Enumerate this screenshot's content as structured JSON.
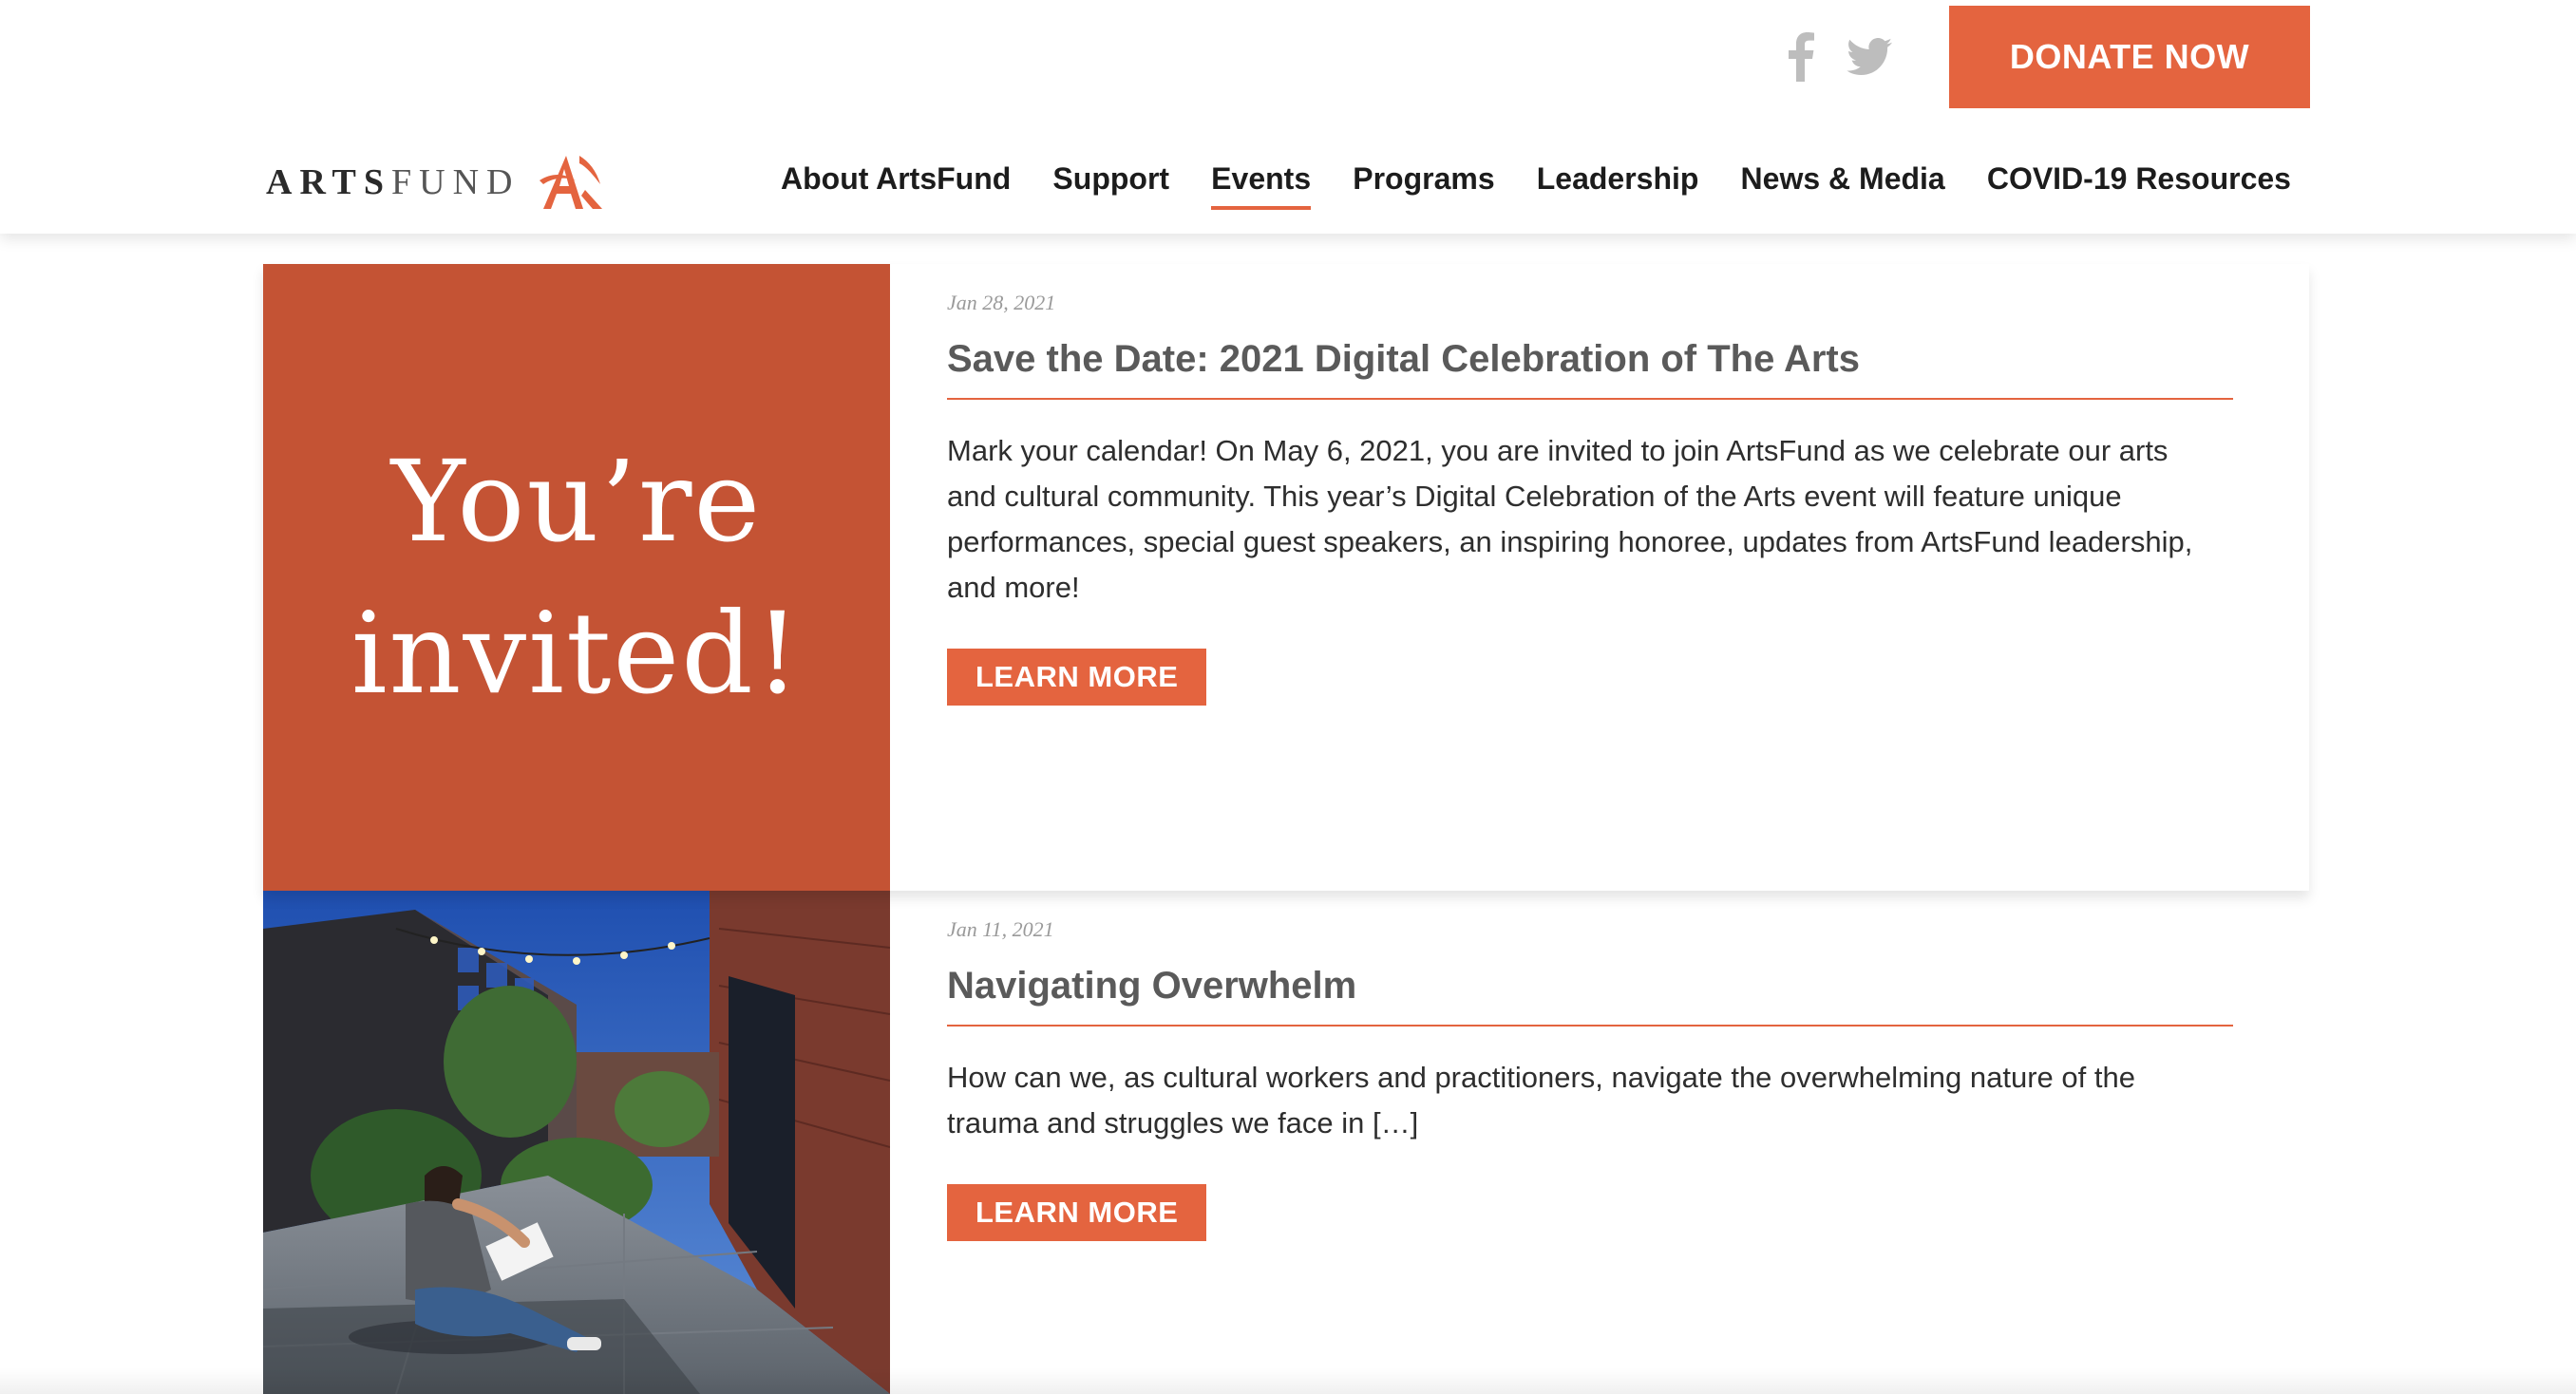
{
  "header": {
    "logo_text_bold": "ARTS",
    "logo_text_light": "FUND",
    "donate_label": "DONATE NOW",
    "social": [
      {
        "icon": "facebook-icon"
      },
      {
        "icon": "twitter-icon"
      }
    ],
    "nav": [
      {
        "label": "About ArtsFund"
      },
      {
        "label": "Support"
      },
      {
        "label": "Events",
        "active": true
      },
      {
        "label": "Programs"
      },
      {
        "label": "Leadership"
      },
      {
        "label": "News & Media"
      },
      {
        "label": "COVID-19 Resources"
      }
    ]
  },
  "posts": [
    {
      "date": "Jan 28, 2021",
      "title": "Save the Date: 2021 Digital Celebration of The Arts",
      "excerpt": "Mark your calendar! On May 6, 2021, you are invited to join ArtsFund as we celebrate our arts and cultural community. This year’s Digital Celebration of the Arts event will feature unique performances, special guest speakers, an inspiring honoree, updates from ArtsFund leadership, and more!",
      "image_text_line1": "You’re",
      "image_text_line2": "invited!",
      "button": "LEARN MORE"
    },
    {
      "date": "Jan 11, 2021",
      "title": "Navigating Overwhelm",
      "excerpt": "How can we, as cultural workers and practitioners, navigate the overwhelming nature of the trauma and struggles we face in […]",
      "button": "LEARN MORE"
    }
  ],
  "colors": {
    "accent": "#e4643f",
    "invite_bg": "#c45334",
    "title": "#5a5a5a",
    "date": "#9a9a9a"
  }
}
